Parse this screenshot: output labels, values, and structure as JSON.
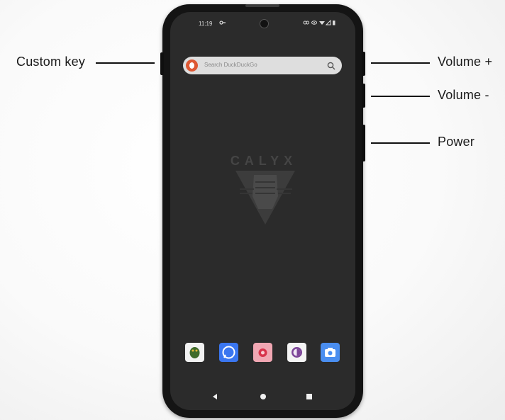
{
  "callouts": {
    "custom_key": "Custom key",
    "volume_up": "Volume +",
    "volume_down": "Volume -",
    "power": "Power"
  },
  "status_bar": {
    "time": "11:19",
    "icons": [
      "key-icon",
      "link-icon",
      "eye-icon",
      "wifi-icon",
      "signal-icon",
      "battery-icon"
    ]
  },
  "search": {
    "placeholder": "Search DuckDuckGo",
    "logo": "duckduckgo-logo",
    "icon": "search-icon"
  },
  "wallpaper": {
    "brand": "CALYX"
  },
  "dock": {
    "apps": [
      {
        "icon": "dragon-app-icon",
        "color": "#f2f2f2"
      },
      {
        "icon": "signal-app-icon",
        "color": "#3a76f0"
      },
      {
        "icon": "flower-app-icon",
        "color": "#f1a7b3"
      },
      {
        "icon": "tor-app-icon",
        "color": "#f4f4f4"
      },
      {
        "icon": "camera-app-icon",
        "color": "#4a8ef0"
      }
    ]
  },
  "navigation": {
    "buttons": [
      "back-icon",
      "home-icon",
      "recents-icon"
    ]
  },
  "colors": {
    "screen": "#2b2b2b",
    "phone_body": "#141414",
    "ddg_orange": "#de5833"
  }
}
